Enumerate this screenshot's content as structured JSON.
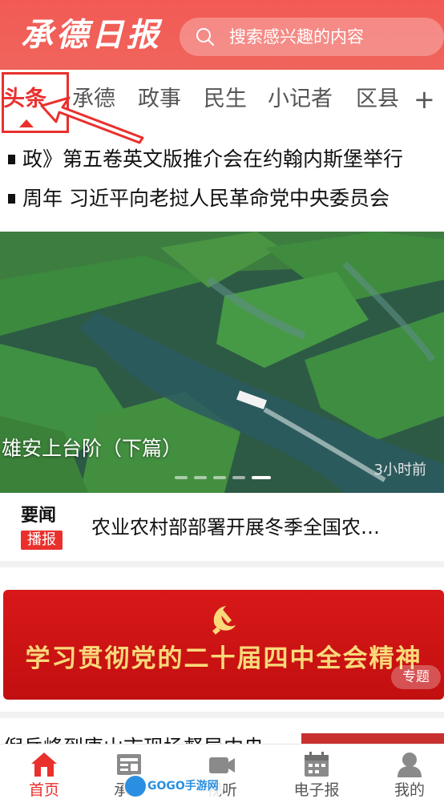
{
  "header": {
    "logo_text": "承德日报",
    "search_placeholder": "搜索感兴趣的内容",
    "brand_color": "#f25a55"
  },
  "tabs": [
    {
      "label": "头条",
      "active": true
    },
    {
      "label": "承德",
      "active": false
    },
    {
      "label": "政事",
      "active": false
    },
    {
      "label": "民生",
      "active": false
    },
    {
      "label": "小记者",
      "active": false
    },
    {
      "label": "区县",
      "active": false
    }
  ],
  "tabs_more": "+",
  "ticker": [
    "政》第五卷英文版推介会在约翰内斯堡举行",
    "周年  习近平向老挝人民革命党中央委员会"
  ],
  "hero": {
    "title": "雄安上台阶（下篇）",
    "time": "3小时前",
    "slide_count": 5,
    "active_slide": 5
  },
  "news_strip": {
    "label_top": "要闻",
    "label_badge": "播报",
    "headline": "农业农村部部署开展冬季全国农…"
  },
  "banner": {
    "slogan": "学习贯彻党的二十届四中全会精神",
    "tag": "专题"
  },
  "partial_row": {
    "text": "倪岳峰到唐山市现场督导中央"
  },
  "bottom_nav": [
    {
      "label": "首页",
      "icon": "home-icon",
      "active": true
    },
    {
      "label": "承德",
      "icon": "newspaper-icon",
      "active": false
    },
    {
      "label": "视听",
      "icon": "video-camera-icon",
      "active": false
    },
    {
      "label": "电子报",
      "icon": "calendar-icon",
      "active": false
    },
    {
      "label": "我的",
      "icon": "user-icon",
      "active": false
    }
  ],
  "watermark": "GOGO手游网",
  "accent_color": "#e9302d"
}
